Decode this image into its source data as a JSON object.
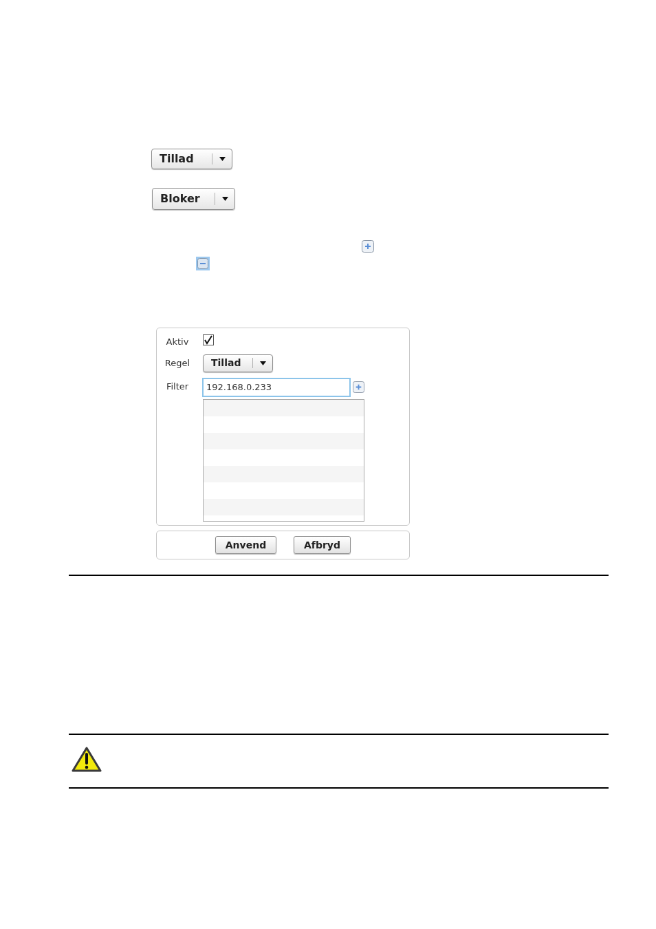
{
  "dropdowns": [
    {
      "label": "Tillad"
    },
    {
      "label": "Bloker"
    }
  ],
  "dialog": {
    "fields": [
      {
        "kind": "checkbox",
        "label": "Aktiv",
        "checked": true
      },
      {
        "kind": "dropdown",
        "label": "Regel",
        "value": "Tillad"
      },
      {
        "kind": "text",
        "label": "Filter",
        "value": "192.168.0.233"
      }
    ],
    "buttons": [
      "Anvend",
      "Afbryd"
    ]
  }
}
